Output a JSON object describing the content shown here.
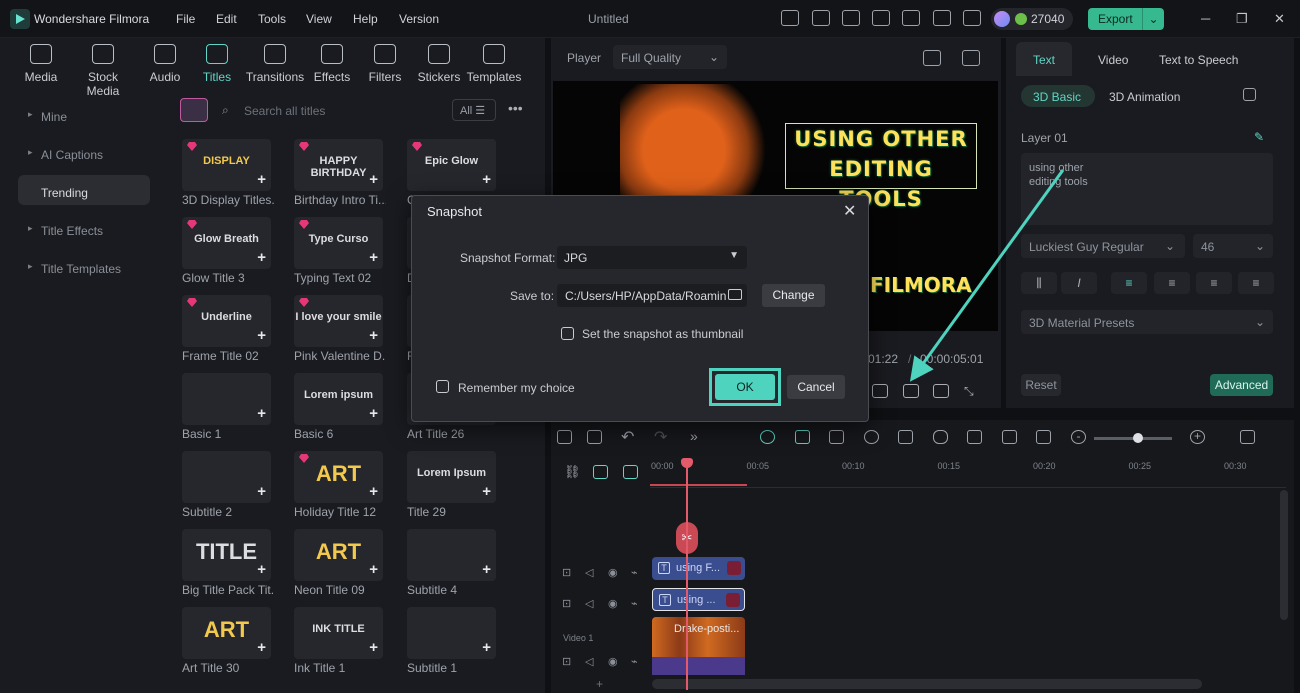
{
  "app": {
    "name": "Wondershare Filmora",
    "doc_title": "Untitled",
    "credits": "27040",
    "export_label": "Export",
    "export_caret": "⌄"
  },
  "menu": [
    "File",
    "Edit",
    "Tools",
    "View",
    "Help",
    "Version"
  ],
  "window_controls": {
    "minimize": "─",
    "restore": "❐",
    "close": "✕"
  },
  "media_tabs": [
    "Media",
    "Stock Media",
    "Audio",
    "Titles",
    "Transitions",
    "Effects",
    "Filters",
    "Stickers",
    "Templates"
  ],
  "sidebar": [
    "Mine",
    "AI Captions",
    "Trending",
    "Title Effects",
    "Title Templates"
  ],
  "search": {
    "placeholder": "Search all titles",
    "filter_label": "All"
  },
  "titles": [
    {
      "label": "3D Display Titles...",
      "thumb": "DISPLAY",
      "gem": true,
      "col": 0,
      "row": 0
    },
    {
      "label": "Birthday Intro Ti...",
      "thumb": "HAPPY BIRTHDAY",
      "gem": true,
      "col": 1,
      "row": 0
    },
    {
      "label": "C",
      "thumb": "Epic Glow",
      "gem": true,
      "col": 2,
      "row": 0
    },
    {
      "label": "Glow Title 3",
      "thumb": "Glow Breath",
      "gem": true,
      "col": 0,
      "row": 1
    },
    {
      "label": "Typing Text 02",
      "thumb": "Type Curso",
      "gem": true,
      "col": 1,
      "row": 1
    },
    {
      "label": "D",
      "thumb": "",
      "gem": false,
      "col": 2,
      "row": 1
    },
    {
      "label": "Frame Title 02",
      "thumb": "Underline",
      "gem": true,
      "col": 0,
      "row": 2
    },
    {
      "label": "Pink Valentine D...",
      "thumb": "I love your smile",
      "gem": true,
      "col": 1,
      "row": 2
    },
    {
      "label": "F",
      "thumb": "",
      "gem": false,
      "col": 2,
      "row": 2
    },
    {
      "label": "Basic 1",
      "thumb": "",
      "gem": false,
      "col": 0,
      "row": 3
    },
    {
      "label": "Basic 6",
      "thumb": "Lorem ipsum",
      "gem": false,
      "col": 1,
      "row": 3
    },
    {
      "label": "Art Title 26",
      "thumb": "",
      "gem": false,
      "col": 2,
      "row": 3
    },
    {
      "label": "Subtitle 2",
      "thumb": "",
      "gem": false,
      "col": 0,
      "row": 4
    },
    {
      "label": "Holiday Title 12",
      "thumb": "ART",
      "gem": true,
      "col": 1,
      "row": 4
    },
    {
      "label": "Title 29",
      "thumb": "Lorem Ipsum",
      "gem": false,
      "col": 2,
      "row": 4
    },
    {
      "label": "Big Title Pack Tit...",
      "thumb": "TITLE",
      "gem": false,
      "col": 0,
      "row": 5
    },
    {
      "label": "Neon Title 09",
      "thumb": "ART",
      "gem": false,
      "col": 1,
      "row": 5
    },
    {
      "label": "Subtitle 4",
      "thumb": "",
      "gem": false,
      "col": 2,
      "row": 5
    },
    {
      "label": "Art Title 30",
      "thumb": "ART",
      "gem": false,
      "col": 0,
      "row": 6
    },
    {
      "label": "Ink Title 1",
      "thumb": "INK TITLE",
      "gem": false,
      "col": 1,
      "row": 6
    },
    {
      "label": "Subtitle 1",
      "thumb": "",
      "gem": false,
      "col": 2,
      "row": 6
    }
  ],
  "player": {
    "label": "Player",
    "quality": "Full Quality",
    "title_line1": "USING OTHER",
    "title_line2": "EDITING TOOLS",
    "title_bottom": "FILMORA",
    "time_current": "01:22",
    "time_total": "00:00:05:01",
    "time_sep": "/"
  },
  "inspector": {
    "tabs": [
      "Text",
      "Video",
      "Text to Speech"
    ],
    "subtabs": [
      "3D Basic",
      "3D Animation"
    ],
    "layer": "Layer 01",
    "text_value": "using other\nediting tools",
    "font": "Luckiest Guy Regular",
    "size": "46",
    "presets": "3D Material Presets",
    "reset": "Reset",
    "advanced": "Advanced"
  },
  "timeline": {
    "ticks": [
      "00:00",
      "00:05",
      "00:10",
      "00:15",
      "00:20",
      "00:25",
      "00:30"
    ],
    "clip_a": "using F...",
    "clip_b": "using ...",
    "video_clip": "Drake-posti...",
    "track_label": "Video 1"
  },
  "dialog": {
    "title": "Snapshot",
    "format_label": "Snapshot Format:",
    "format_value": "JPG",
    "save_label": "Save to:",
    "path": "C:/Users/HP/AppData/Roamin",
    "change": "Change",
    "thumbnail_option": "Set the snapshot as thumbnail",
    "remember": "Remember my choice",
    "ok": "OK",
    "cancel": "Cancel"
  },
  "colors": {
    "accent": "#4ed3be",
    "annotation_arrow": "#4ed3be",
    "premium_gem": "#e5377a",
    "title_yellow": "#ffe15a"
  }
}
